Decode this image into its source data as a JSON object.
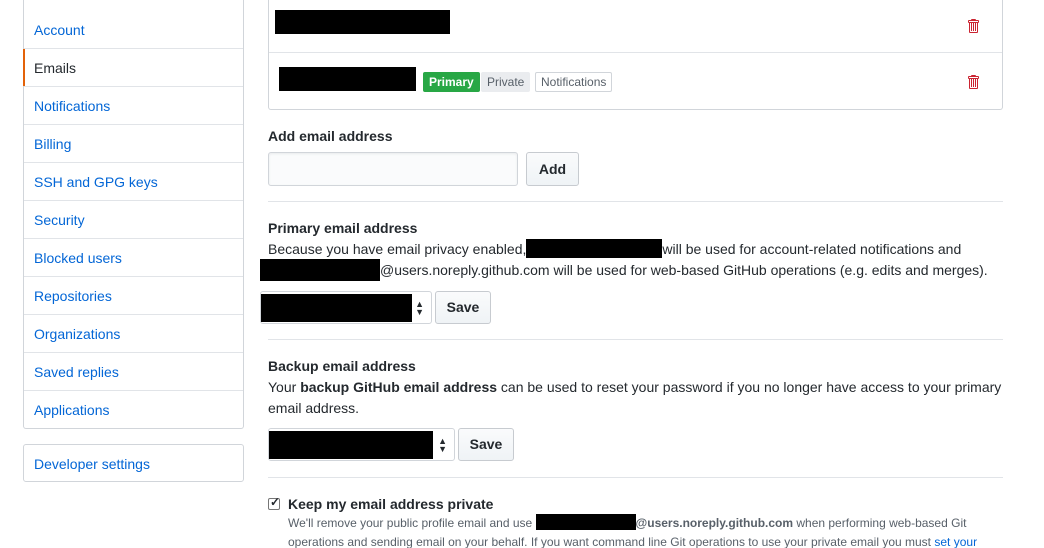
{
  "sidebar": {
    "items": [
      {
        "label": "Account"
      },
      {
        "label": "Emails"
      },
      {
        "label": "Notifications"
      },
      {
        "label": "Billing"
      },
      {
        "label": "SSH and GPG keys"
      },
      {
        "label": "Security"
      },
      {
        "label": "Blocked users"
      },
      {
        "label": "Repositories"
      },
      {
        "label": "Organizations"
      },
      {
        "label": "Saved replies"
      },
      {
        "label": "Applications"
      }
    ],
    "developer_settings": "Developer settings"
  },
  "emails": {
    "badges": {
      "primary": "Primary",
      "private": "Private",
      "notifications": "Notifications"
    }
  },
  "add_email": {
    "heading": "Add email address",
    "input_value": "",
    "button": "Add"
  },
  "primary_email": {
    "heading": "Primary email address",
    "line1_a": "Because you have email privacy enabled,",
    "line1_b": "will be used for account-related notifications and",
    "line2": "@users.noreply.github.com will be used for web-based GitHub operations (e.g. edits and merges).",
    "save": "Save"
  },
  "backup_email": {
    "heading": "Backup email address",
    "line1_a": "Your ",
    "line1_bold": "backup GitHub email address",
    "line1_b": " can be used to reset your password if you no longer have access to your primary",
    "line2": "email address.",
    "save": "Save"
  },
  "keep_private": {
    "label": "Keep my email address private",
    "checked": true,
    "note1_a": "We'll remove your public profile email and use",
    "note1_bold": "@users.noreply.github.com",
    "note1_b": " when performing web-based Git",
    "note2": "operations and sending email on your behalf. If you want command line Git operations to use your private email you must",
    "note2_link": "set your"
  },
  "colors": {
    "link": "#0366d6",
    "primary_badge": "#28a745",
    "trash": "#cb2431",
    "selected_indicator": "#e36209"
  }
}
